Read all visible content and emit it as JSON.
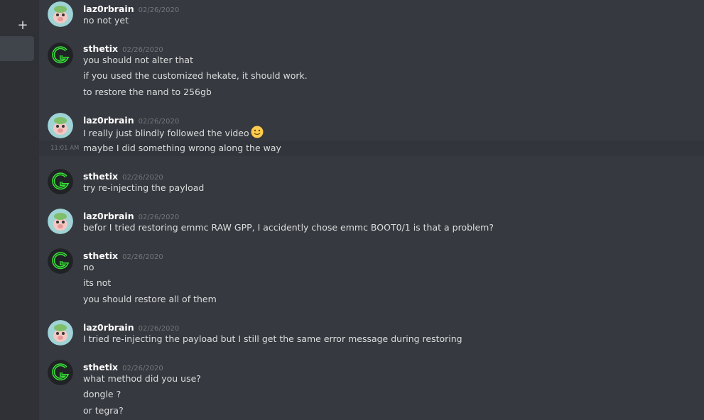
{
  "sidebar": {
    "add_glyph": "+"
  },
  "messages": [
    {
      "user": "laz0rbrain",
      "timestamp": "02/26/2020",
      "avatar": "pig-avatar",
      "lines": [
        "no not yet"
      ]
    },
    {
      "user": "sthetix",
      "timestamp": "02/26/2020",
      "avatar": "green-g-logo",
      "lines": [
        "you should not alter that",
        "if you used the customized hekate, it should work.",
        "to restore the nand to 256gb"
      ]
    },
    {
      "user": "laz0rbrain",
      "timestamp": "02/26/2020",
      "avatar": "pig-avatar",
      "lines": [
        "I really just blindly followed the video",
        "maybe I did something wrong along the way"
      ],
      "emoji": "slightly-smiling-face",
      "hover_time": "11:01 AM"
    },
    {
      "user": "sthetix",
      "timestamp": "02/26/2020",
      "avatar": "green-g-logo",
      "lines": [
        "try re-injecting the payload"
      ]
    },
    {
      "user": "laz0rbrain",
      "timestamp": "02/26/2020",
      "avatar": "pig-avatar",
      "lines": [
        "befor I tried restoring emmc RAW GPP, I accidently chose emmc BOOT0/1 is that a problem?"
      ]
    },
    {
      "user": "sthetix",
      "timestamp": "02/26/2020",
      "avatar": "green-g-logo",
      "lines": [
        "no",
        "its not",
        "you should restore all of them"
      ]
    },
    {
      "user": "laz0rbrain",
      "timestamp": "02/26/2020",
      "avatar": "pig-avatar",
      "lines": [
        "I tried re-injecting the payload but I still get the same error message during restoring"
      ]
    },
    {
      "user": "sthetix",
      "timestamp": "02/26/2020",
      "avatar": "green-g-logo",
      "lines": [
        "what method did you use?",
        "dongle ?",
        "or tegra?"
      ]
    }
  ],
  "colors": {
    "background": "#36393f",
    "sidebar": "#2f3136",
    "username": "#ffffff",
    "text": "#dcddde",
    "timestamp": "#72767d",
    "logo_green": "#3ddc3d"
  }
}
